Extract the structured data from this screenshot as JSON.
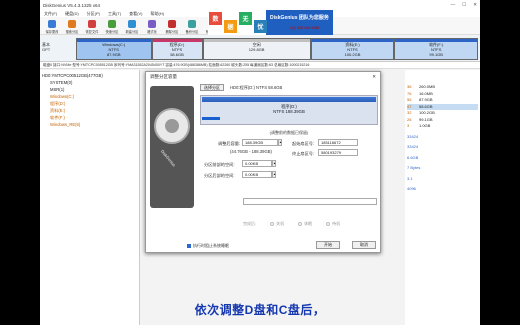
{
  "window": {
    "title": "DiskGenius V5.4.3.1325 x64",
    "controls": [
      "—",
      "☐",
      "✕"
    ]
  },
  "menu": [
    "文件(F)",
    "硬盘(D)",
    "分区(P)",
    "工具(T)",
    "查看(V)",
    "帮助(H)"
  ],
  "toolbar": [
    {
      "label": "保存更改",
      "color": "#3a7bd5"
    },
    {
      "label": "搜索分区",
      "color": "#e07a1f"
    },
    {
      "label": "恢复文件",
      "color": "#d04040"
    },
    {
      "label": "快速分区",
      "color": "#4a9d3c"
    },
    {
      "label": "新建分区",
      "color": "#2f8fd0"
    },
    {
      "label": "格式化",
      "color": "#7a5cc7"
    },
    {
      "label": "删除分区",
      "color": "#c03030"
    },
    {
      "label": "备份分区",
      "color": "#3aa0a0"
    },
    {
      "label": "系统迁移",
      "color": "#5070c0"
    }
  ],
  "banner": {
    "tiles": [
      {
        "ch": "数",
        "color": "#e74c3c"
      },
      {
        "ch": "据",
        "color": "#f39c12"
      },
      {
        "ch": "无",
        "color": "#27ae60"
      },
      {
        "ch": "忧",
        "color": "#2980b9"
      }
    ],
    "brand": "DiskGenius 团队为您服务",
    "phone": "QQ: 400-008-9958"
  },
  "disk": {
    "info_line1": "基本",
    "info_line2": "GPT",
    "partitions": [
      {
        "name": "Windows(C:)",
        "fs": "NTFS",
        "size": "87.9GB",
        "color": "#9fc4f0",
        "top": "#2c64c8",
        "flex": 9
      },
      {
        "name": "程序(D:)",
        "fs": "NTFS",
        "size": "58.6GB",
        "color": "#d6e4f5",
        "top": "#c8386b",
        "flex": 6
      },
      {
        "name": "空闲",
        "fs": "",
        "size": "129.8GB",
        "color": "#eef2f6",
        "top": "#c0c0c0",
        "flex": 13
      },
      {
        "name": "资料(E:)",
        "fs": "NTFS",
        "size": "100.2GB",
        "color": "#bfd7f2",
        "top": "#2c64c8",
        "flex": 10
      },
      {
        "name": "软件(F:)",
        "fs": "NTFS",
        "size": "99.1GB",
        "color": "#bfd7f2",
        "top": "#2c64c8",
        "flex": 10
      }
    ],
    "details": "磁盘0 接口:NVMe 型号:YMTCPC005512GB 序列号:YMA31552A2045400YT 容量:476.9GB(488386MB) 柱面数:62260 磁头数:255 每道扇区数:63 总扇区数:1000215216"
  },
  "tree": {
    "disk": "HD0:YMTCPC00512GB(477GB)",
    "nodes": [
      {
        "label": "SYSTEM(0)",
        "orange": false
      },
      {
        "label": "MSR(1)",
        "orange": false
      },
      {
        "label": "Windows(C:)",
        "orange": true
      },
      {
        "label": "程序(D:)",
        "orange": true
      },
      {
        "label": "资料(E:)",
        "orange": true
      },
      {
        "label": "软件(F:)",
        "orange": true
      },
      {
        "label": "Windows_RE(6)",
        "orange": true
      }
    ]
  },
  "right": {
    "rows": [
      {
        "n": "36",
        "v": "260.0MB",
        "sel": false
      },
      {
        "n": "76",
        "v": "16.0MB",
        "sel": false
      },
      {
        "n": "55",
        "v": "87.9GB",
        "sel": false
      },
      {
        "n": "47",
        "v": "58.6GB",
        "sel": true
      },
      {
        "n": "32",
        "v": "100.2GB",
        "sel": false
      },
      {
        "n": "26",
        "v": "99.1GB",
        "sel": false
      },
      {
        "n": "3",
        "v": "1.0GB",
        "sel": false
      }
    ],
    "extra": [
      "33424",
      "33424",
      "6.6GB",
      "7 Bytes",
      "3.1",
      "4096"
    ]
  },
  "dialog": {
    "title": "调整分区容量",
    "close": "✕",
    "select_button": "选择分区",
    "selected_part": "HD0:程序(D:) NTFS 58.6GB",
    "bar_name": "程序(D:)",
    "bar_detail": "NTFS 188.39GB",
    "note": "(调整前的数据已保留)",
    "resize_label": "调整后容量:",
    "resize_value": "188.39GB",
    "resize_sub": "(44.76GB - 188.39GB)",
    "start_label": "起始扇区号:",
    "start_value": "185116672",
    "end_label": "终止扇区号:",
    "end_value": "580193279",
    "before_label": "分区前部的空间:",
    "before_value": "0.00KB",
    "after_label": "分区后部的空间:",
    "after_value": "0.00KB",
    "options": [
      "完成后:",
      "关机",
      "休眠",
      "待机"
    ],
    "checkbox_label": "执行时阻止系统睡眠",
    "start_btn": "开始",
    "cancel_btn": "取消",
    "hdd_label": "DiskGenius"
  },
  "subtitle": "依次调整D盘和C盘后，"
}
